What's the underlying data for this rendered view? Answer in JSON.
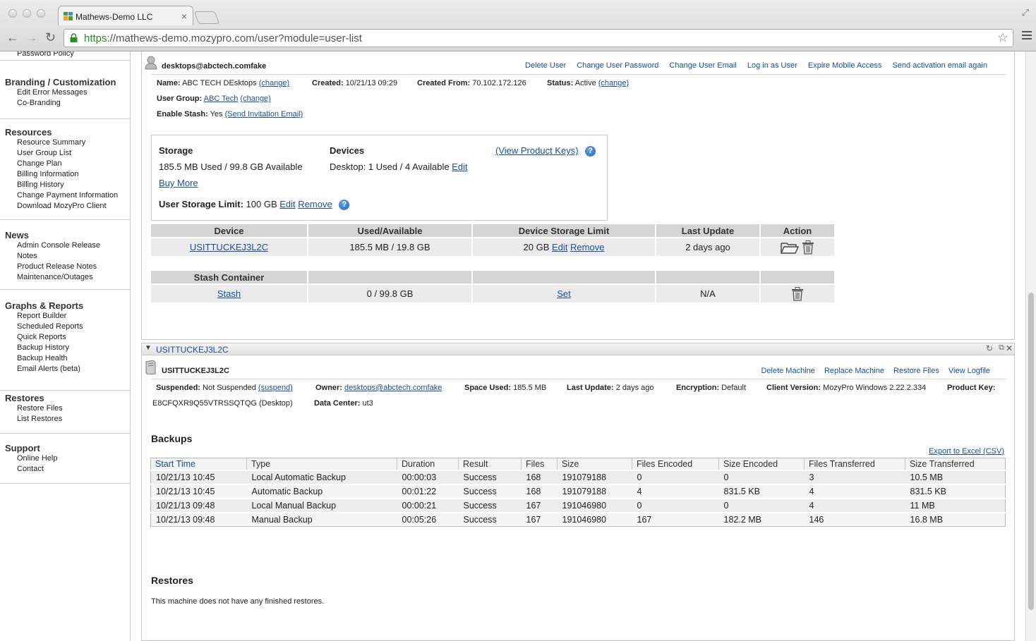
{
  "browser": {
    "tab_title": "Mathews-Demo LLC",
    "url_scheme": "https",
    "url_rest": "://mathews-demo.mozypro.com/user?module=user-list"
  },
  "sidebar": {
    "top_item": "Password Policy",
    "sections": [
      {
        "title": "Branding / Customization",
        "items": [
          "Edit Error Messages",
          "Co-Branding"
        ]
      },
      {
        "title": "Resources",
        "items": [
          "Resource Summary",
          "User Group List",
          "Change Plan",
          "Billing Information",
          "Billing History",
          "Change Payment Information",
          "Download MozyPro Client"
        ]
      },
      {
        "title": "News",
        "items": [
          "Admin Console Release",
          "Notes",
          "Product Release Notes",
          "Maintenance/Outages"
        ]
      },
      {
        "title": "Graphs & Reports",
        "items": [
          "Report Builder",
          "Scheduled Reports",
          "Quick Reports",
          "Backup History",
          "Backup Health",
          "Email Alerts (beta)"
        ]
      },
      {
        "title": "Restores",
        "items": [
          "Restore Files",
          "List Restores"
        ]
      },
      {
        "title": "Support",
        "items": [
          "Online Help",
          "Contact"
        ]
      }
    ]
  },
  "user": {
    "email": "desktops@abctech.comfake",
    "actions": [
      "Delete User",
      "Change User Password",
      "Change User Email",
      "Log in as User",
      "Expire Mobile Access",
      "Send activation email again"
    ],
    "name_label": "Name:",
    "name": "ABC TECH DEsktops",
    "change": "(change)",
    "created_label": "Created:",
    "created": "10/21/13 09:29",
    "created_from_label": "Created From:",
    "created_from": "70.102.172.126",
    "status_label": "Status:",
    "status": "Active",
    "group_label": "User Group:",
    "group": "ABC Tech",
    "stash_label": "Enable Stash:",
    "stash": "Yes",
    "send_invite": "(Send Invitation Email)"
  },
  "storage": {
    "title": "Storage",
    "used": "185.5 MB Used / 99.8 GB Available",
    "buy_more": "Buy More",
    "limit_label": "User Storage Limit:",
    "limit": "100 GB",
    "edit": "Edit",
    "remove": "Remove",
    "devices_title": "Devices",
    "devices": "Desktop: 1 Used / 4 Available",
    "view_keys": "(View Product Keys)",
    "help": "?"
  },
  "device_table": {
    "headers": [
      "Device",
      "Used/Available",
      "Device Storage Limit",
      "Last Update",
      "Action"
    ],
    "row": {
      "device": "USITTUCKEJ3L2C",
      "used": "185.5 MB / 19.8 GB",
      "limit": "20 GB",
      "edit": "Edit",
      "remove": "Remove",
      "last_update": "2 days ago"
    }
  },
  "stash_table": {
    "header": "Stash Container",
    "row": {
      "name": "Stash",
      "used": "0 / 99.8 GB",
      "set": "Set",
      "last_update": "N/A"
    }
  },
  "machine": {
    "bar_title": "USITTUCKEJ3L2C",
    "name": "USITTUCKEJ3L2C",
    "actions": [
      "Delete Machine",
      "Replace Machine",
      "Restore Files",
      "View Logfile"
    ],
    "suspended_label": "Suspended:",
    "suspended": "Not Suspended",
    "suspend_link": "(suspend)",
    "owner_label": "Owner:",
    "owner": "desktops@abctech.comfake",
    "space_label": "Space Used:",
    "space": "185.5 MB",
    "last_update_label": "Last Update:",
    "last_update": "2 days ago",
    "encryption_label": "Encryption:",
    "encryption": "Default",
    "client_label": "Client Version:",
    "client": "MozyPro Windows 2.22.2.334",
    "key_label": "Product Key:",
    "key": "E8CFQXR9Q55VTRSSQTQG (Desktop)",
    "dc_label": "Data Center:",
    "dc": "ut3"
  },
  "backups": {
    "title": "Backups",
    "export": "Export to Excel (CSV)",
    "headers": [
      "Start Time",
      "Type",
      "Duration",
      "Result",
      "Files",
      "Size",
      "Files Encoded",
      "Size Encoded",
      "Files Transferred",
      "Size Transferred"
    ],
    "rows": [
      [
        "10/21/13 10:45",
        "Local Automatic Backup",
        "00:00:03",
        "Success",
        "168",
        "191079188",
        "0",
        "0",
        "3",
        "10.5 MB"
      ],
      [
        "10/21/13 10:45",
        "Automatic Backup",
        "00:01:22",
        "Success",
        "168",
        "191079188",
        "4",
        "831.5 KB",
        "4",
        "831.5 KB"
      ],
      [
        "10/21/13 09:48",
        "Local Manual Backup",
        "00:00:21",
        "Success",
        "167",
        "191046980",
        "0",
        "0",
        "4",
        "11 MB"
      ],
      [
        "10/21/13 09:48",
        "Manual Backup",
        "00:05:26",
        "Success",
        "167",
        "191046980",
        "167",
        "182.2 MB",
        "146",
        "16.8 MB"
      ]
    ]
  },
  "restores": {
    "title": "Restores",
    "empty": "This machine does not have any finished restores."
  }
}
